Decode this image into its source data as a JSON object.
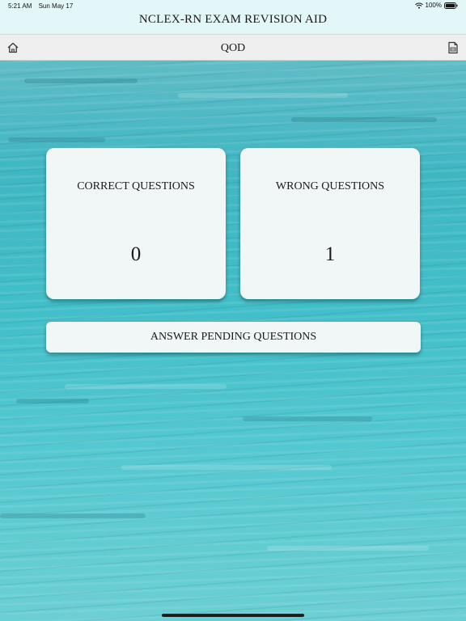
{
  "status_bar": {
    "time": "5:21 AM",
    "date": "Sun May 17",
    "battery": "100%",
    "wifi_icon": "wifi-icon",
    "battery_icon": "battery-icon"
  },
  "header": {
    "app_title": "NCLEX-RN EXAM REVISION AID"
  },
  "nav": {
    "title": "QOD",
    "left_icon": "home-icon",
    "right_icon": "document-icon"
  },
  "stats": {
    "correct": {
      "label": "CORRECT QUESTIONS",
      "value": "0"
    },
    "wrong": {
      "label": "WRONG QUESTIONS",
      "value": "1"
    }
  },
  "actions": {
    "pending_label": "ANSWER PENDING QUESTIONS"
  },
  "colors": {
    "header_bg": "#e3f6f8",
    "nav_bg": "#efefef",
    "background_teal": "#42bfc9",
    "card_bg": "#f1f6f7"
  }
}
